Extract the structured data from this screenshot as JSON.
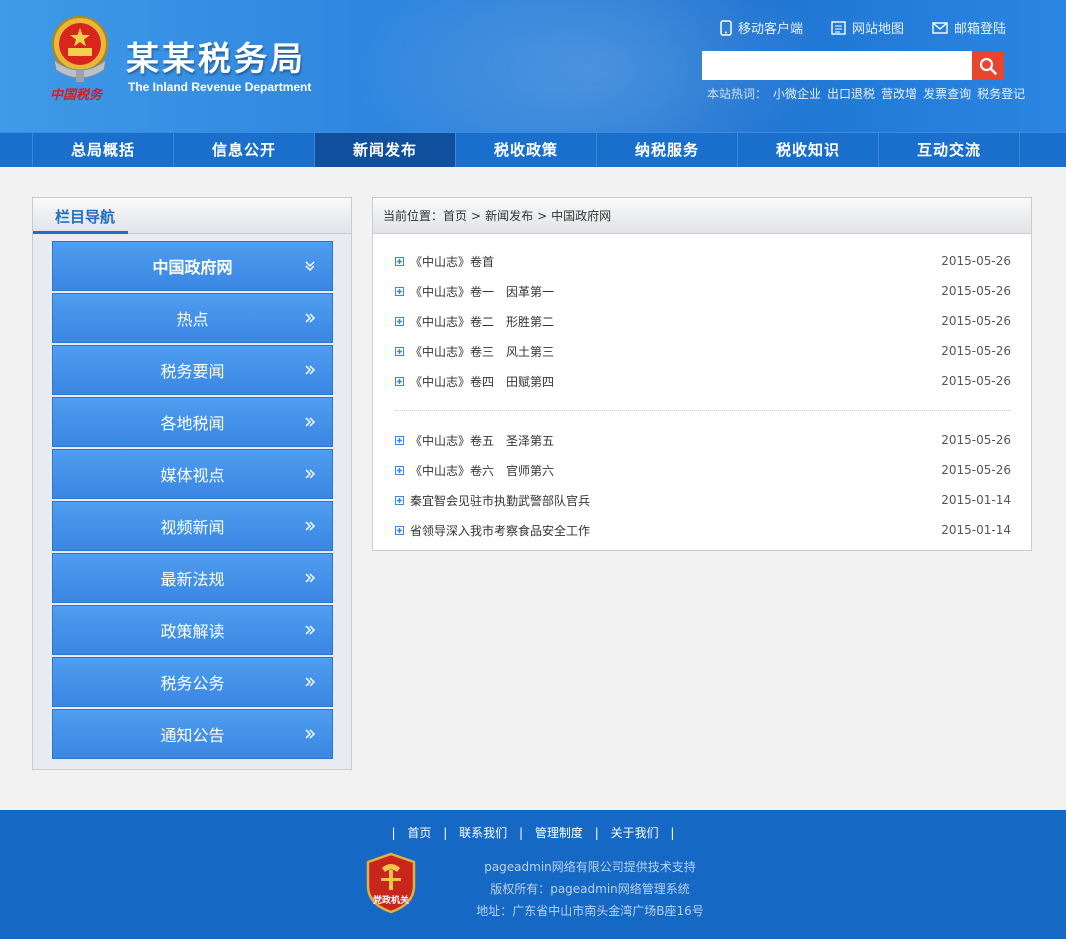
{
  "header": {
    "emblem_text": "中国税务",
    "title": "某某税务局",
    "subtitle": "The Inland Revenue Department",
    "toplinks": [
      {
        "label": "移动客户端",
        "icon": "mobile-icon"
      },
      {
        "label": "网站地图",
        "icon": "sitemap-icon"
      },
      {
        "label": "邮箱登陆",
        "icon": "mail-icon"
      }
    ],
    "search": {
      "placeholder": "",
      "value": ""
    },
    "hotwords_label": "本站热词：",
    "hotwords": [
      "小微企业",
      "出口退税",
      "营改增",
      "发票查询",
      "税务登记"
    ]
  },
  "nav": {
    "items": [
      "总局概括",
      "信息公开",
      "新闻发布",
      "税收政策",
      "纳税服务",
      "税收知识",
      "互动交流"
    ],
    "active_index": 2
  },
  "sidebar": {
    "title": "栏目导航",
    "items": [
      "中国政府网",
      "热点",
      "税务要闻",
      "各地税闻",
      "媒体视点",
      "视频新闻",
      "最新法规",
      "政策解读",
      "税务公务",
      "通知公告"
    ]
  },
  "content": {
    "breadcrumb": {
      "label": "当前位置：",
      "path": [
        "首页",
        "新闻发布",
        "中国政府网"
      ],
      "sep": ">"
    },
    "news_group1": [
      {
        "title": "《中山志》卷首",
        "date": "2015-05-26"
      },
      {
        "title": "《中山志》卷一　因革第一",
        "date": "2015-05-26"
      },
      {
        "title": "《中山志》卷二　形胜第二",
        "date": "2015-05-26"
      },
      {
        "title": "《中山志》卷三　风土第三",
        "date": "2015-05-26"
      },
      {
        "title": "《中山志》卷四　田赋第四",
        "date": "2015-05-26"
      }
    ],
    "news_group2": [
      {
        "title": "《中山志》卷五　圣泽第五",
        "date": "2015-05-26"
      },
      {
        "title": "《中山志》卷六　官师第六",
        "date": "2015-05-26"
      },
      {
        "title": "秦宜智会见驻市执勤武警部队官兵",
        "date": "2015-01-14"
      },
      {
        "title": "省领导深入我市考察食品安全工作",
        "date": "2015-01-14"
      }
    ]
  },
  "footer": {
    "links": [
      "首页",
      "联系我们",
      "管理制度",
      "关于我们"
    ],
    "badge_text": "党政机关",
    "support": "pageadmin网络有限公司提供技术支持",
    "copyright": "版权所有：pageadmin网络管理系统",
    "address": "地址：广东省中山市南头金湾广场B座16号"
  },
  "colors": {
    "header_blue": "#2f86df",
    "nav_blue": "#1b6fcc",
    "nav_active": "#0f4f9e",
    "search_btn": "#e8452e",
    "footer_blue": "#1668c5"
  }
}
